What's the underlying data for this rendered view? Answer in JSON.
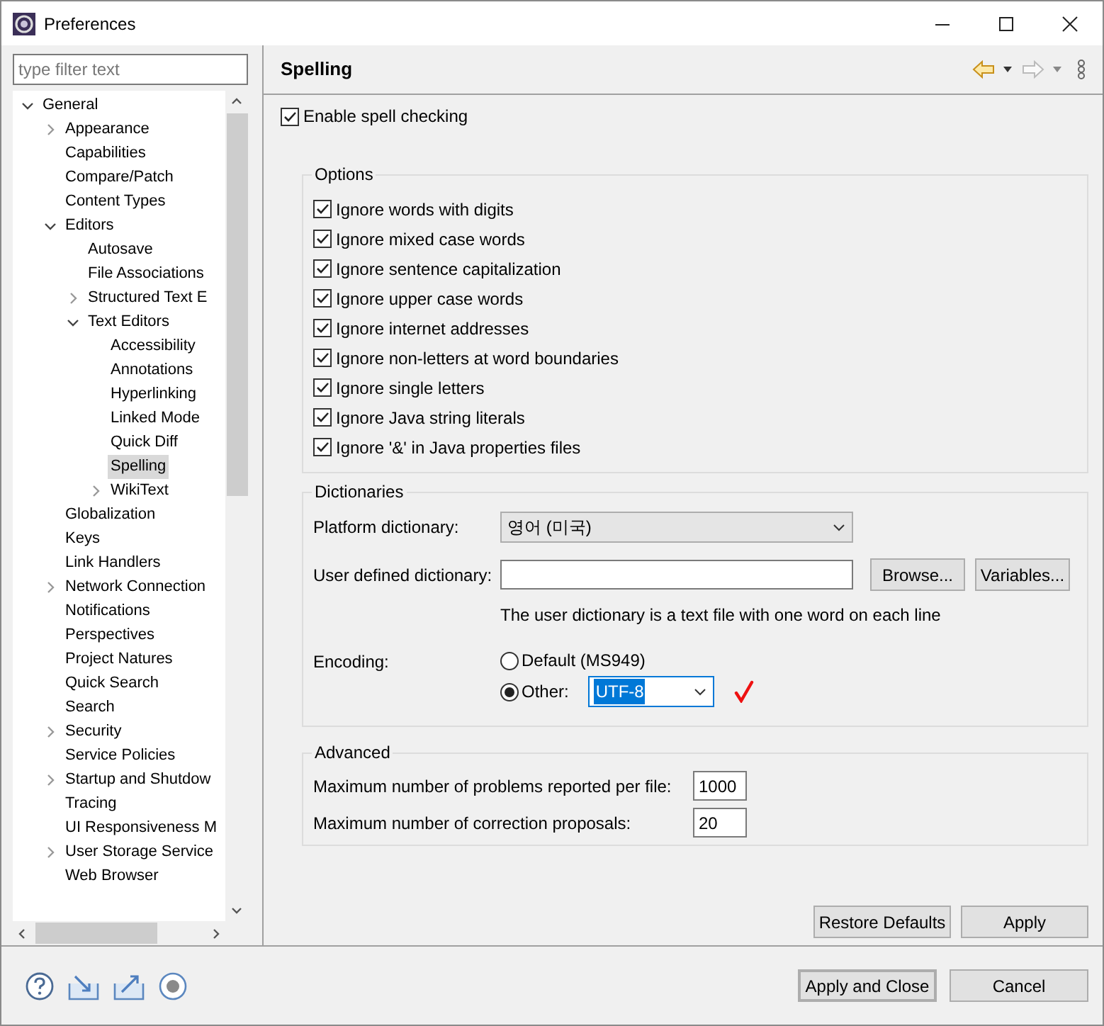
{
  "window": {
    "title": "Preferences"
  },
  "sidebar": {
    "filter": {
      "placeholder": "type filter text"
    },
    "tree": [
      {
        "label": "General",
        "expanded": true,
        "selected": false,
        "children": [
          {
            "label": "Appearance",
            "expanded": false,
            "selected": false
          },
          {
            "label": "Capabilities",
            "selected": false
          },
          {
            "label": "Compare/Patch",
            "selected": false
          },
          {
            "label": "Content Types",
            "selected": false
          },
          {
            "label": "Editors",
            "expanded": true,
            "selected": false,
            "children": [
              {
                "label": "Autosave",
                "selected": false
              },
              {
                "label": "File Associations",
                "selected": false
              },
              {
                "label": "Structured Text E",
                "expanded": false,
                "selected": false
              },
              {
                "label": "Text Editors",
                "expanded": true,
                "selected": false,
                "children": [
                  {
                    "label": "Accessibility",
                    "selected": false
                  },
                  {
                    "label": "Annotations",
                    "selected": false
                  },
                  {
                    "label": "Hyperlinking",
                    "selected": false
                  },
                  {
                    "label": "Linked Mode",
                    "selected": false
                  },
                  {
                    "label": "Quick Diff",
                    "selected": false
                  },
                  {
                    "label": "Spelling",
                    "selected": true
                  },
                  {
                    "label": "WikiText",
                    "expanded": false,
                    "selected": false
                  }
                ]
              }
            ]
          },
          {
            "label": "Globalization",
            "selected": false
          },
          {
            "label": "Keys",
            "selected": false
          },
          {
            "label": "Link Handlers",
            "selected": false
          },
          {
            "label": "Network Connection",
            "expanded": false,
            "selected": false
          },
          {
            "label": "Notifications",
            "selected": false
          },
          {
            "label": "Perspectives",
            "selected": false
          },
          {
            "label": "Project Natures",
            "selected": false
          },
          {
            "label": "Quick Search",
            "selected": false
          },
          {
            "label": "Search",
            "selected": false
          },
          {
            "label": "Security",
            "expanded": false,
            "selected": false
          },
          {
            "label": "Service Policies",
            "selected": false
          },
          {
            "label": "Startup and Shutdow",
            "expanded": false,
            "selected": false
          },
          {
            "label": "Tracing",
            "selected": false
          },
          {
            "label": "UI Responsiveness M",
            "selected": false
          },
          {
            "label": "User Storage Service",
            "expanded": false,
            "selected": false
          },
          {
            "label": "Web Browser",
            "selected": false
          }
        ]
      }
    ]
  },
  "page": {
    "title": "Spelling"
  },
  "enable_spell_checking": {
    "label": "Enable spell checking",
    "checked": true
  },
  "options": {
    "title": "Options",
    "items": [
      {
        "label": "Ignore words with digits",
        "checked": true
      },
      {
        "label": "Ignore mixed case words",
        "checked": true
      },
      {
        "label": "Ignore sentence capitalization",
        "checked": true
      },
      {
        "label": "Ignore upper case words",
        "checked": true
      },
      {
        "label": "Ignore internet addresses",
        "checked": true
      },
      {
        "label": "Ignore non-letters at word boundaries",
        "checked": true
      },
      {
        "label": "Ignore single letters",
        "checked": true
      },
      {
        "label": "Ignore Java string literals",
        "checked": true
      },
      {
        "label": "Ignore '&' in Java properties files",
        "checked": true
      }
    ]
  },
  "dictionaries": {
    "title": "Dictionaries",
    "platform_dictionary": {
      "label": "Platform dictionary:",
      "value": "영어 (미국)"
    },
    "user_dictionary": {
      "label": "User defined dictionary:",
      "buttons": [
        "Browse...",
        "Variables..."
      ]
    },
    "hint": "The user dictionary is a text file with one word on each line",
    "encoding": {
      "label": "Encoding:",
      "options": [
        {
          "label": "Default (MS949)",
          "selected": false
        },
        {
          "label": "Other:",
          "selected": true
        }
      ],
      "other_value": "UTF-8",
      "focused": true
    }
  },
  "advanced": {
    "title": "Advanced",
    "fields": [
      {
        "label": "Maximum number of problems reported per file:",
        "value": "1000"
      },
      {
        "label": "Maximum number of correction proposals:",
        "value": "20"
      }
    ]
  },
  "page_buttons": [
    "Restore Defaults",
    "Apply"
  ],
  "dialog_buttons": [
    {
      "label": "Apply and Close",
      "default": true
    },
    {
      "label": "Cancel",
      "default": false
    }
  ]
}
